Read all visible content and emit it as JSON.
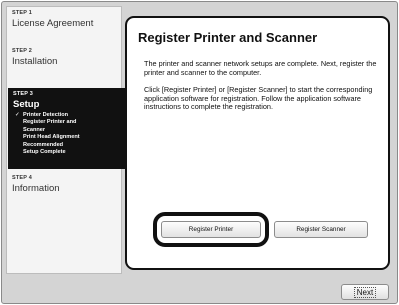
{
  "sidebar": {
    "steps": [
      {
        "number": "STEP 1",
        "label": "License Agreement"
      },
      {
        "number": "STEP 2",
        "label": "Installation"
      },
      {
        "number": "STEP 3",
        "label": "Setup",
        "subitems": [
          "Printer Detection",
          "Register Printer and",
          "Scanner",
          "Print Head Alignment",
          "Recommended",
          "Setup Complete"
        ],
        "checked_subitem": "Printer Detection"
      },
      {
        "number": "STEP 4",
        "label": "Information"
      }
    ],
    "check_glyph": "✓"
  },
  "main": {
    "title": "Register Printer and Scanner",
    "paragraph1": "The printer and scanner network setups are complete. Next, register the printer and scanner to the computer.",
    "paragraph2": "Click [Register Printer] or [Register Scanner] to start the corresponding application software for registration. Follow the application software instructions to complete the registration.",
    "buttons": {
      "register_printer": "Register Printer",
      "register_scanner": "Register Scanner"
    }
  },
  "footer": {
    "next_label": "Next"
  },
  "colors": {
    "active_step_bg": "#111111",
    "window_bg": "#d4d4d4",
    "panel_border": "#111111"
  }
}
